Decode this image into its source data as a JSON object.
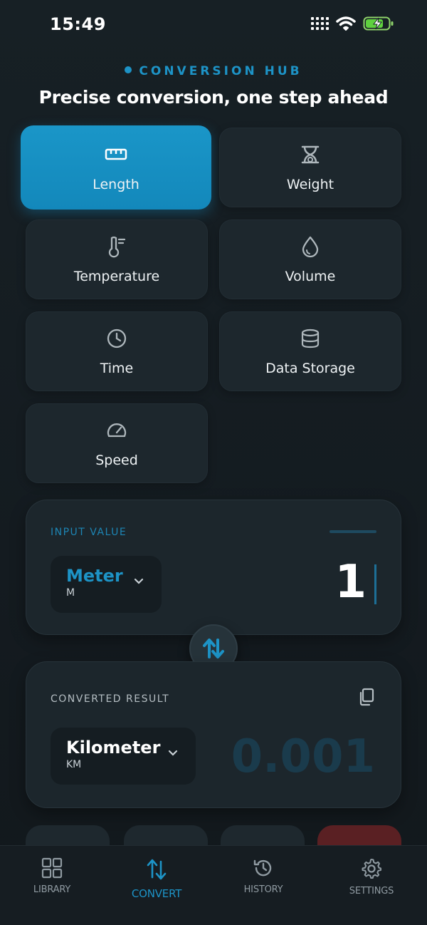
{
  "status_bar": {
    "time": "15:49"
  },
  "header": {
    "kicker": "CONVERSION HUB",
    "headline": "Precise conversion, one step ahead"
  },
  "categories": [
    {
      "label": "Length",
      "icon": "ruler-icon",
      "active": true
    },
    {
      "label": "Weight",
      "icon": "scale-icon",
      "active": false
    },
    {
      "label": "Temperature",
      "icon": "thermometer-icon",
      "active": false
    },
    {
      "label": "Volume",
      "icon": "droplet-icon",
      "active": false
    },
    {
      "label": "Time",
      "icon": "clock-icon",
      "active": false
    },
    {
      "label": "Data Storage",
      "icon": "database-icon",
      "active": false
    },
    {
      "label": "Speed",
      "icon": "speedometer-icon",
      "active": false
    }
  ],
  "input_panel": {
    "title": "INPUT VALUE",
    "unit_name": "Meter",
    "unit_abbr": "M",
    "value": "1"
  },
  "result_panel": {
    "title": "CONVERTED RESULT",
    "unit_name": "Kilometer",
    "unit_abbr": "KM",
    "value": "0.001"
  },
  "bottom_nav": {
    "items": [
      {
        "label": "LIBRARY",
        "icon": "grid-icon",
        "active": false
      },
      {
        "label": "CONVERT",
        "icon": "convert-arrows-icon",
        "active": true
      },
      {
        "label": "HISTORY",
        "icon": "history-icon",
        "active": false
      },
      {
        "label": "SETTINGS",
        "icon": "gear-icon",
        "active": false
      }
    ]
  },
  "colors": {
    "accent": "#1d93c6",
    "background": "#131a1f",
    "card": "#1d272d",
    "result_value": "#1a3b4c"
  }
}
